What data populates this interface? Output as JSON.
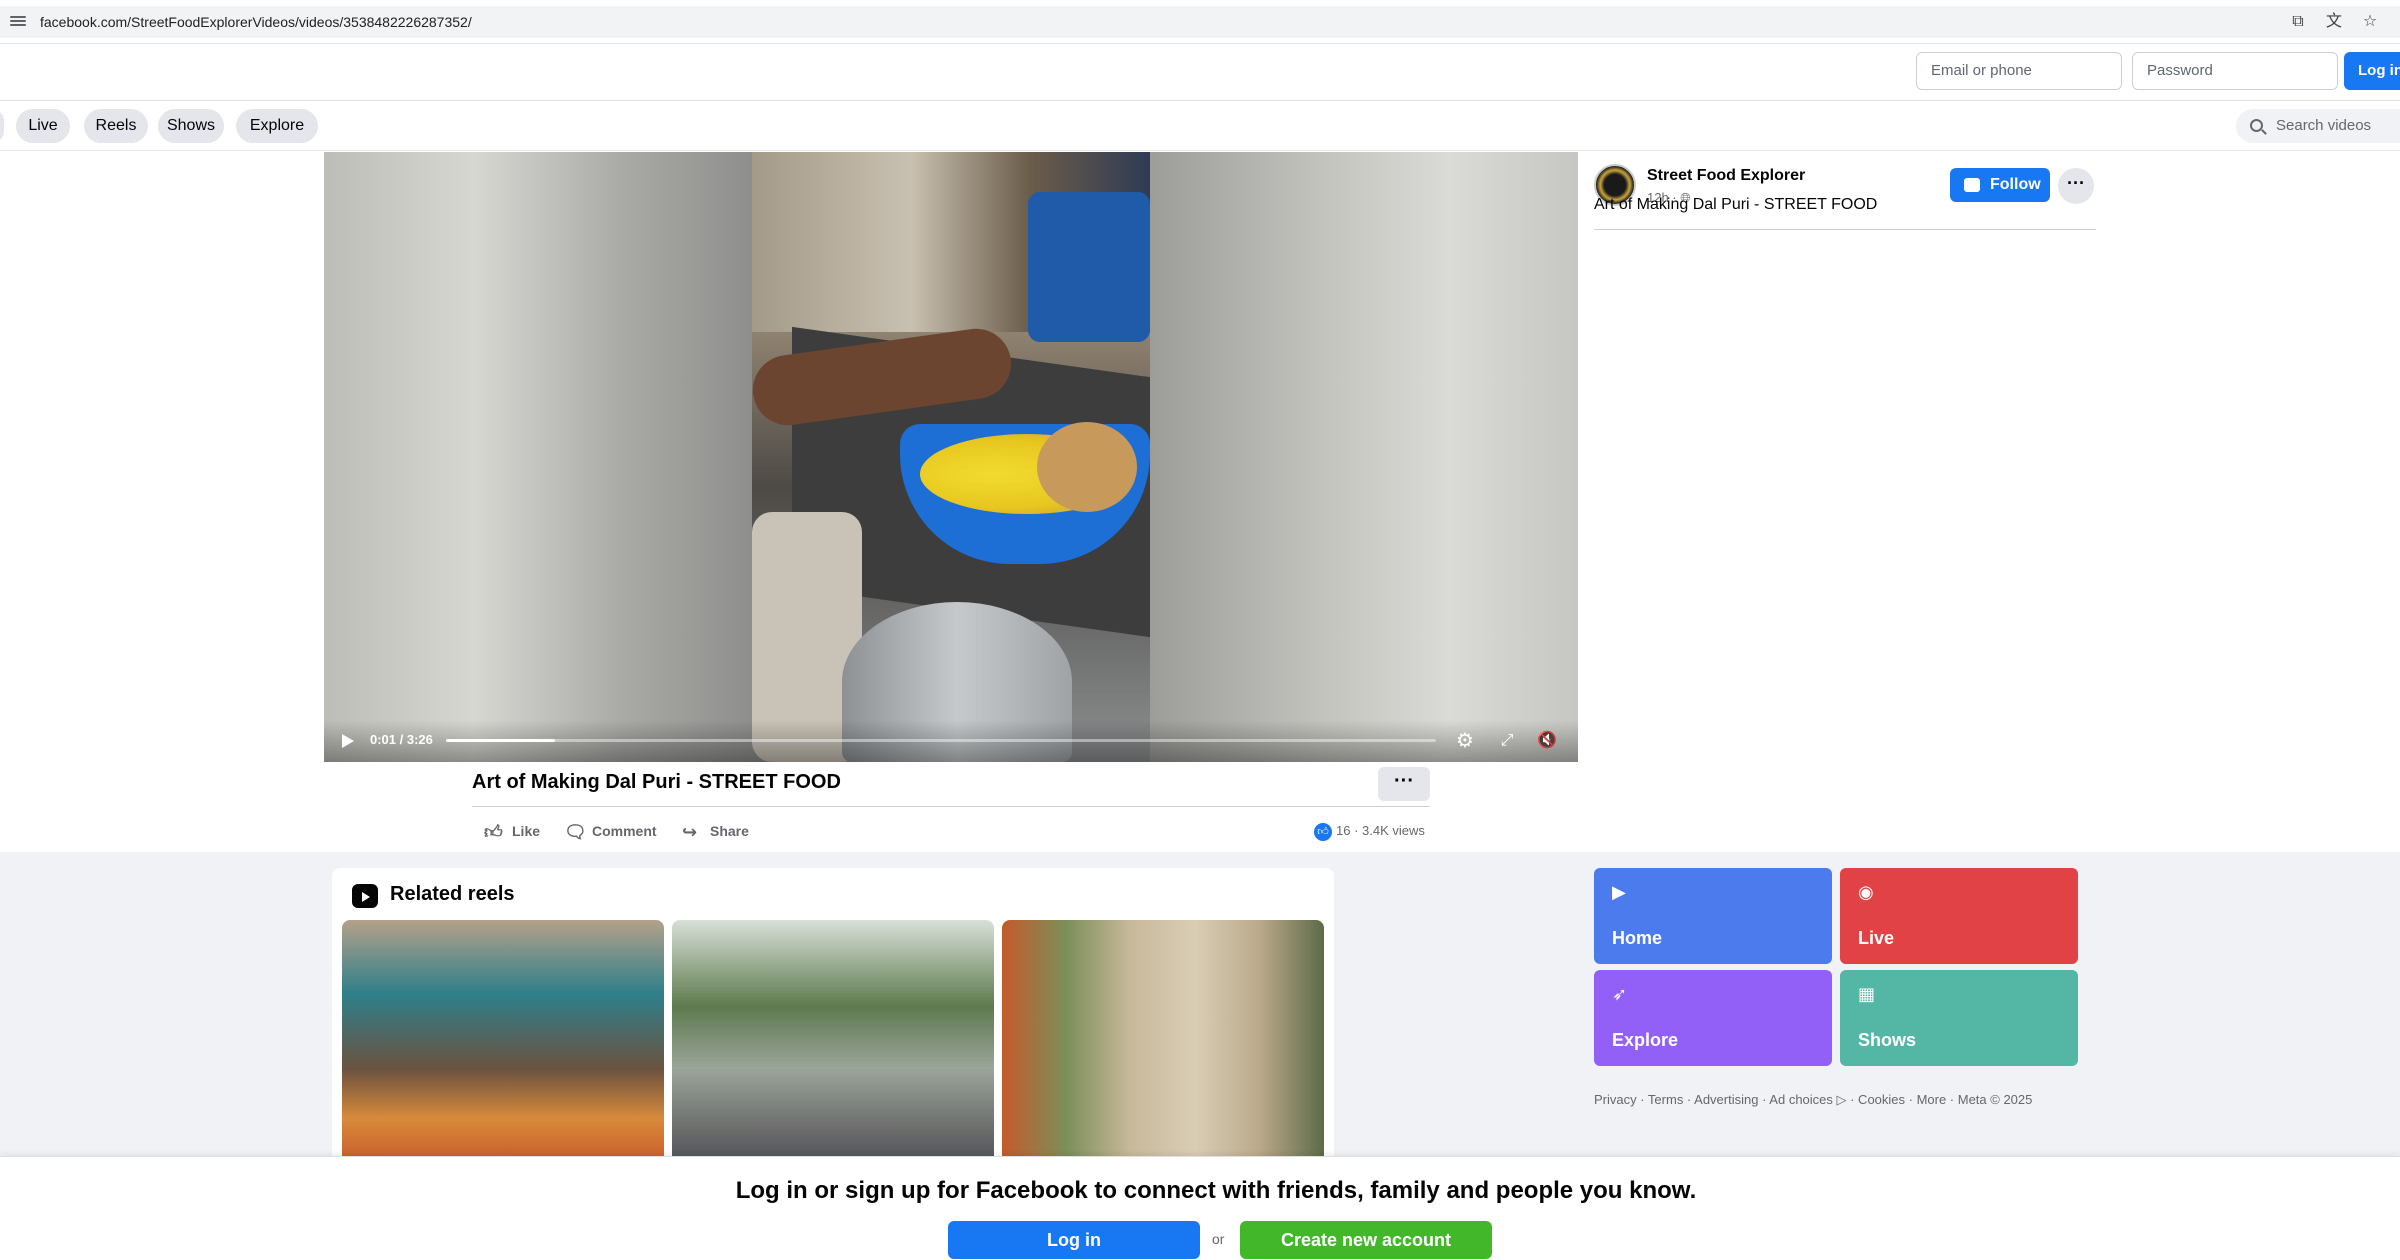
{
  "browser": {
    "url": "facebook.com/StreetFoodExplorerVideos/videos/3538482226287352/"
  },
  "header": {
    "email_placeholder": "Email or phone",
    "password_placeholder": "Password",
    "login_label": "Log in"
  },
  "nav": {
    "pills": [
      "Live",
      "Reels",
      "Shows",
      "Explore"
    ],
    "search_placeholder": "Search videos"
  },
  "video": {
    "time": "0:01 / 3:26",
    "progress": 0.11,
    "title": "Art of Making Dal Puri - STREET FOOD",
    "more_label": "···",
    "actions": {
      "like": "Like",
      "comment": "Comment",
      "share": "Share"
    },
    "reaction_count": "16",
    "views": "3.4K views"
  },
  "channel": {
    "name": "Street Food Explorer",
    "meta": "12h · ",
    "description": "Art of Making Dal Puri - STREET FOOD",
    "follow_label": "Follow",
    "more_label": "···"
  },
  "related": {
    "heading": "Related reels"
  },
  "tiles": {
    "home": "Home",
    "live": "Live",
    "explore": "Explore",
    "shows": "Shows"
  },
  "footer": {
    "links": "Privacy · Terms · Advertising · Ad choices ▷ · Cookies · More · Meta © 2025"
  },
  "bottom": {
    "prompt": "Log in or sign up for Facebook to connect with friends, family and people you know.",
    "login": "Log in",
    "or": "or",
    "create": "Create new account"
  },
  "colors": {
    "brand": "#1877f2",
    "create": "#42b72a",
    "tile_home": "#4b7bec",
    "tile_live": "#e04246",
    "tile_explore": "#9360f7",
    "tile_shows": "#54b7a6"
  }
}
